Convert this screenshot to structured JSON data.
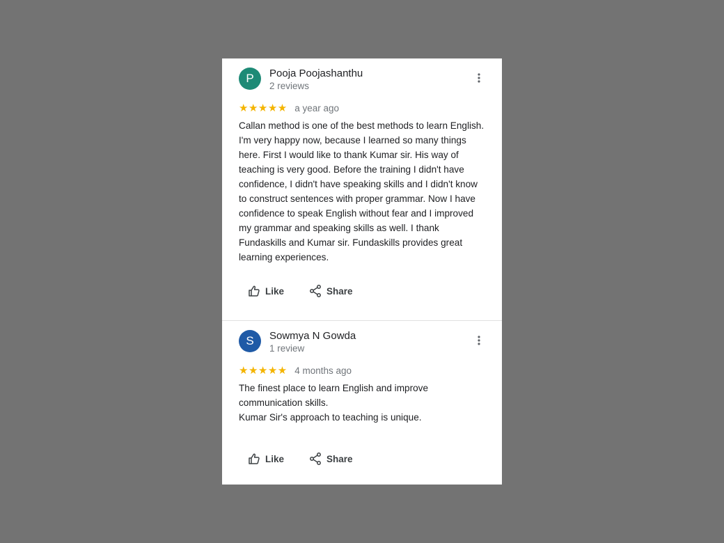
{
  "reviews": [
    {
      "initial": "P",
      "avatar_color": "#1e8a76",
      "name": "Pooja Poojashanthu",
      "review_count": "2 reviews",
      "stars": "★★★★★",
      "rating": 5,
      "time": "a year ago",
      "text": [
        "Callan method is one of the best methods to learn English. I'm very happy now, because I learned so many things here. First I would like to thank Kumar sir. His way of teaching is very good. Before the training I didn't have confidence, I didn't have speaking skills and I didn't know to construct sentences with proper grammar. Now I have confidence to speak English without fear and I improved my grammar and speaking skills as well. I thank Fundaskills and Kumar sir. Fundaskills provides great learning experiences."
      ],
      "like_label": "Like",
      "share_label": "Share"
    },
    {
      "initial": "S",
      "avatar_color": "#1f5aa6",
      "name": "Sowmya N Gowda",
      "review_count": "1 review",
      "stars": "★★★★★",
      "rating": 5,
      "time": "4 months ago",
      "text": [
        "The finest place to learn English and improve communication skills.",
        "Kumar Sir's approach to teaching is unique."
      ],
      "like_label": "Like",
      "share_label": "Share"
    }
  ],
  "icons": {
    "more": "more-vert-icon",
    "like": "thumb-up-icon",
    "share": "share-icon"
  },
  "colors": {
    "background": "#737373",
    "star": "#f4b400"
  }
}
